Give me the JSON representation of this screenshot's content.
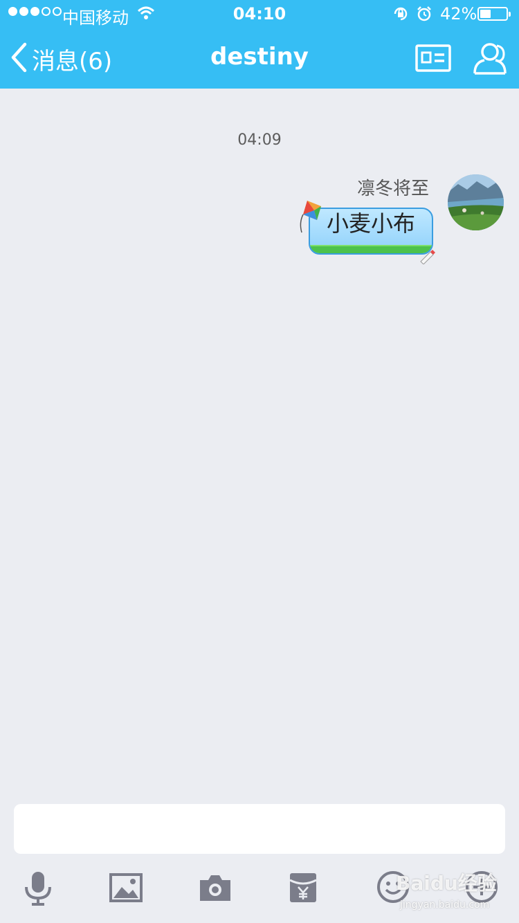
{
  "status_bar": {
    "carrier": "中国移动",
    "time": "04:10",
    "battery_percent": "42%",
    "battery_level": 0.42,
    "signal_bars": 3
  },
  "nav": {
    "back_label": "消息(6)",
    "title": "destiny",
    "right_icons": [
      "profile-card-icon",
      "contacts-icon"
    ]
  },
  "chat": {
    "timestamp": "04:09",
    "messages": [
      {
        "sender": "凛冬将至",
        "text": "小麦小布",
        "bubble_theme": "kite-sky",
        "side": "right"
      }
    ]
  },
  "input": {
    "value": "",
    "placeholder": ""
  },
  "toolbar": {
    "icons": [
      "microphone-icon",
      "image-icon",
      "camera-icon",
      "red-packet-icon",
      "emoji-icon",
      "plus-icon"
    ]
  },
  "watermark": {
    "text": "Baidu经验",
    "sub": "jingyan.baidu.com"
  },
  "colors": {
    "header": "#36bef4",
    "background": "#ebedf2",
    "icon": "#7b7d8a",
    "bubble": "#a9dcfc"
  }
}
